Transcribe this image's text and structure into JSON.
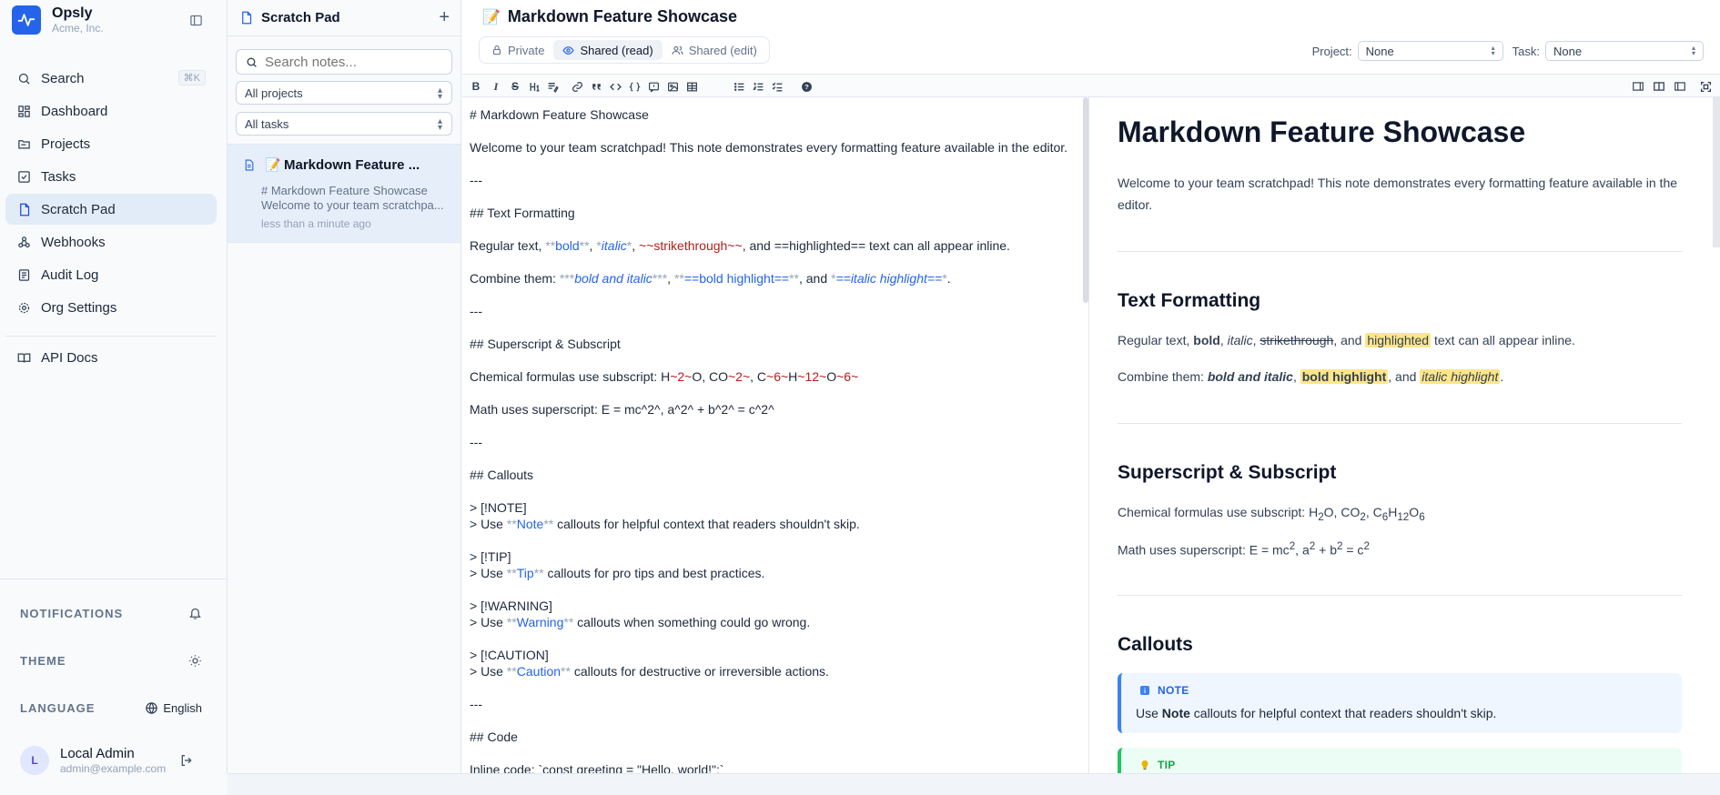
{
  "app": {
    "name": "Opsly",
    "org": "Acme, Inc."
  },
  "nav": {
    "search": {
      "label": "Search",
      "shortcut": "⌘K"
    },
    "items": [
      {
        "label": "Dashboard",
        "icon": "dashboard-icon"
      },
      {
        "label": "Projects",
        "icon": "folder-icon"
      },
      {
        "label": "Tasks",
        "icon": "checkbox-icon"
      },
      {
        "label": "Scratch Pad",
        "icon": "document-icon",
        "active": true
      },
      {
        "label": "Webhooks",
        "icon": "webhook-icon"
      },
      {
        "label": "Audit Log",
        "icon": "list-icon"
      },
      {
        "label": "Org Settings",
        "icon": "gear-icon"
      }
    ],
    "api_docs": "API Docs",
    "footer": {
      "notifications": "NOTIFICATIONS",
      "theme": "THEME",
      "language": "LANGUAGE",
      "language_value": "English"
    },
    "user": {
      "initial": "L",
      "name": "Local Admin",
      "email": "admin@example.com"
    }
  },
  "notes": {
    "title": "Scratch Pad",
    "search_placeholder": "Search notes...",
    "project_filter": "All projects",
    "task_filter": "All tasks",
    "items": [
      {
        "emoji": "📝",
        "title": "Markdown Feature ...",
        "line1": "# Markdown Feature Showcase",
        "line2": "Welcome to your team scratchpa...",
        "time": "less than a minute ago"
      }
    ]
  },
  "editor": {
    "emoji": "📝",
    "title": "Markdown Feature Showcase",
    "visibility": [
      {
        "label": "Private",
        "icon": "lock-icon"
      },
      {
        "label": "Shared (read)",
        "icon": "eye-icon",
        "active": true
      },
      {
        "label": "Shared (edit)",
        "icon": "users-icon"
      }
    ],
    "project_label": "Project:",
    "project_value": "None",
    "task_label": "Task:",
    "task_value": "None",
    "source": {
      "l1": "# Markdown Feature Showcase",
      "l2": "Welcome to your team scratchpad! This note demonstrates every formatting feature available in the editor.",
      "hr": "---",
      "h_text": "## Text Formatting",
      "regular": {
        "a": "Regular text, ",
        "b1": "**",
        "b2": "bold",
        "b3": "**",
        "c": ", ",
        "i1": "*",
        "i2": "italic",
        "i3": "*",
        "d": ", ",
        "s1": "~~",
        "s2": "strikethrough",
        "s3": "~~",
        "e": ", and ==highlighted== text can all appear inline."
      },
      "combine": {
        "a": "Combine them: ",
        "m1": "***",
        "t1": "bold and italic",
        "m2": "***",
        "c1": ", ",
        "m3": "**",
        "t2": "==bold highlight==",
        "m4": "**",
        "c2": ", and ",
        "m5": "*",
        "t3": "==italic highlight==",
        "m6": "*",
        "c3": "."
      },
      "h_sup": "## Superscript & Subscript",
      "chem": {
        "a": "Chemical formulas use subscript: H",
        "s1": "~2~",
        "b": "O, CO",
        "s2": "~2~",
        "c": ", C",
        "s3": "~6~",
        "d": "H",
        "s4": "~12~",
        "e": "O",
        "s5": "~6~"
      },
      "math": "Math uses superscript: E = mc^2^, a^2^ + b^2^ = c^2^",
      "h_callouts": "## Callouts",
      "note_tag": "> [!NOTE]",
      "note_line": {
        "a": "> Use ",
        "m": "**",
        "t": "Note",
        "m2": "**",
        "b": " callouts for helpful context that readers shouldn't skip."
      },
      "tip_tag": "> [!TIP]",
      "tip_line": {
        "a": "> Use ",
        "m": "**",
        "t": "Tip",
        "m2": "**",
        "b": " callouts for pro tips and best practices."
      },
      "warn_tag": "> [!WARNING]",
      "warn_line": {
        "a": "> Use ",
        "m": "**",
        "t": "Warning",
        "m2": "**",
        "b": " callouts when something could go wrong."
      },
      "caution_tag": "> [!CAUTION]",
      "caution_line": {
        "a": "> Use ",
        "m": "**",
        "t": "Caution",
        "m2": "**",
        "b": " callouts for destructive or irreversible actions."
      },
      "h_code": "## Code",
      "inline_code": "Inline code: `const greeting = \"Hello, world!\";`"
    },
    "preview": {
      "h1": "Markdown Feature Showcase",
      "intro": "Welcome to your team scratchpad! This note demonstrates every formatting feature available in the editor.",
      "h_text": "Text Formatting",
      "regular": {
        "a": "Regular text, ",
        "bold": "bold",
        "c": ", ",
        "italic": "italic",
        "d": ", ",
        "strike": "strikethrough",
        "e": ", and ",
        "hl": "highlighted",
        "f": " text can all appear inline."
      },
      "combine": {
        "a": "Combine them: ",
        "bi": "bold and italic",
        "c": ", ",
        "bh": "bold highlight",
        "d": ", and ",
        "ih": "italic highlight",
        "e": "."
      },
      "h_sup": "Superscript & Subscript",
      "chem": {
        "a": "Chemical formulas use subscript: H",
        "s1": "2",
        "b": "O, CO",
        "s2": "2",
        "c": ", C",
        "s3": "6",
        "d": "H",
        "s4": "12",
        "e": "O",
        "s5": "6"
      },
      "math": {
        "a": "Math uses superscript: E = mc",
        "p1": "2",
        "b": ", a",
        "p2": "2",
        "c": " + b",
        "p3": "2",
        "d": " = c",
        "p4": "2"
      },
      "h_callouts": "Callouts",
      "note": {
        "title": "NOTE",
        "a": "Use ",
        "b": "Note",
        "c": " callouts for helpful context that readers shouldn't skip."
      },
      "tip": {
        "title": "TIP"
      }
    }
  }
}
